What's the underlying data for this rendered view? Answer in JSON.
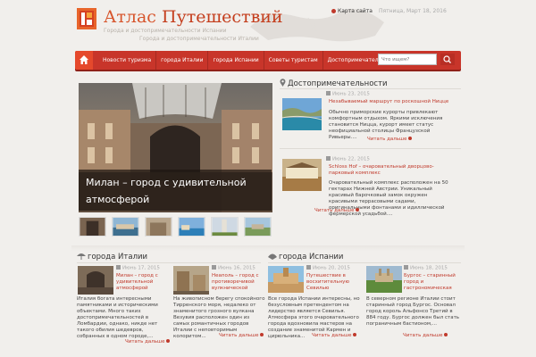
{
  "header": {
    "title_part1": "Атлас",
    "title_part2": "Путешествий",
    "tagline_line1": "Города и достопримечательности Испании",
    "tagline_line2": "Города и достопримечательности Италии",
    "sitemap_label": "Карта сайта",
    "date_text": "Пятница, Март 18, 2016"
  },
  "nav": {
    "items": [
      {
        "label": "Новости туризма"
      },
      {
        "label": "города Италии"
      },
      {
        "label": "города Испании"
      },
      {
        "label": "Советы туристам"
      },
      {
        "label": "Достопримечательности"
      }
    ],
    "search_placeholder": "Что ищем?"
  },
  "slider": {
    "caption": "Милан – город с удивительной атмосферой"
  },
  "sights": {
    "heading": "Достопримечательности",
    "posts": [
      {
        "date": "Июнь 23, 2015",
        "title": "Незабываемый маршрут по роскошной Ницце",
        "excerpt": "Обычно приморские курорты привлекают комфортным отдыхом. Яркими исключения становится Ницца, курорт имеет статус неофициальной столицы Французской Ривьеры....",
        "readmore": "Читать дальше"
      },
      {
        "date": "Июнь 22, 2015",
        "title": "Schloss Hof – очаровательный дворцово-парковый комплекс",
        "excerpt": "Очаровательный комплекс расположен на 50 гектарах Нижней Австрии. Уникальный красивый барочковый замок окружен красивыми террасовыми садами, оригинальными фонтанами и идиллической фермерской усадьбой....",
        "readmore": "Читать дальше"
      }
    ]
  },
  "italy": {
    "heading": "города Италии",
    "posts": [
      {
        "date": "Июнь 17, 2015",
        "title": "Милан – город с удивительной атмосферой",
        "excerpt": "Италия богата интересными памятниками и историческими объектами. Много таких достопримечательностей в Ломбардии, однако, никде нет такого обилия шедевров, собранных в одном городе,...",
        "readmore": "Читать дальше"
      },
      {
        "date": "Июнь 16, 2015",
        "title": "Неаполь – город с противоречивой вулкнической",
        "excerpt": "На живописном берегу спокойного Тирренского моря, недалеко от знаменитого грозного вулкана Везувия расположен один из самых романтичных городов Италии с неповторимым колоритом...",
        "readmore": "Читать дальше"
      }
    ]
  },
  "spain": {
    "heading": "города Испании",
    "posts": [
      {
        "date": "Июнь 20, 2015",
        "title": "Путешествие в восхитительную Севилью",
        "excerpt": "Все города Испании интересны, но безусловным претендентом на лидерство является Севилья. Атмосфера этого очаровательного города вдохновила мастеров на создание знаменитой Кармен и цирюльника...",
        "readmore": "Читать дальше"
      },
      {
        "date": "Июнь 18, 2015",
        "title": "Бургос – старинный город и гастрономическая",
        "excerpt": "В северном регионе Италии стоит старинный город Бургос. Основал город король Альфонсо Третий в 884 году. Бургос должен был стать пограничным бастионом,...",
        "readmore": "Читать дальше"
      }
    ]
  }
}
